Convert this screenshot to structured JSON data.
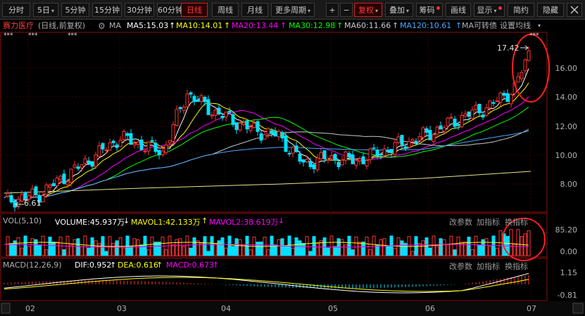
{
  "toolbar": {
    "period_tabs": [
      "分时",
      "5日",
      "5分钟",
      "15分钟",
      "30分钟",
      "60分钟",
      "日线",
      "周线",
      "月线",
      "更多周期"
    ],
    "active_tab": "日线",
    "tools": [
      "复权",
      "叠加",
      "筹码",
      "画线",
      "显示",
      "简约",
      "隐藏"
    ],
    "plus": "+",
    "minus": "−",
    "caret": "▾"
  },
  "stock": {
    "name": "赛力医疗",
    "mode": "(日线,前复权)",
    "ma_label": "MA",
    "ma5": "MA5:15.03",
    "ma10": "MA10:14.01",
    "ma20": "MA20:13.44",
    "ma30": "MA30:12.98",
    "ma60": "MA60:11.66",
    "ma120": "MA120:10.61",
    "conv": "MA可转债",
    "settings": "设置均线",
    "up_arrow": "↑"
  },
  "colors": {
    "up": "#ff3232",
    "down": "#00e0ff",
    "ma5": "#ffffff",
    "ma10": "#ffff00",
    "ma20": "#ff00ff",
    "ma30": "#00ff00",
    "ma60": "#c8c8c8",
    "ma120": "#4aa8ff",
    "ma250": "#e6e68c"
  },
  "price_axis": [
    "16.00",
    "14.00",
    "12.00",
    "10.00",
    "8.00"
  ],
  "annotations": {
    "high": "17.42",
    "low": "6.61",
    "stars": "***"
  },
  "volume": {
    "label": "VOL(5,10)",
    "volume": "VOLUME:45.937万",
    "mavol1": "MAVOL1:42.133万",
    "mavol2": "MAVOL2:38.619万",
    "axis_top": "85.20",
    "axis_bottom": "0.00",
    "arrow_down": "↓",
    "arrow_up": "↑"
  },
  "macd": {
    "label": "MACD(12,26,9)",
    "dif": "DIF:0.952",
    "dea": "DEA:0.616",
    "macd": "MACD:0.673",
    "axis_top": "1.15",
    "axis_bottom": "-0.81",
    "arrow_up": "↑"
  },
  "panel_buttons": [
    "改参数",
    "加指标",
    "换指标"
  ],
  "months": [
    "02",
    "03",
    "04",
    "05",
    "06",
    "07"
  ]
}
